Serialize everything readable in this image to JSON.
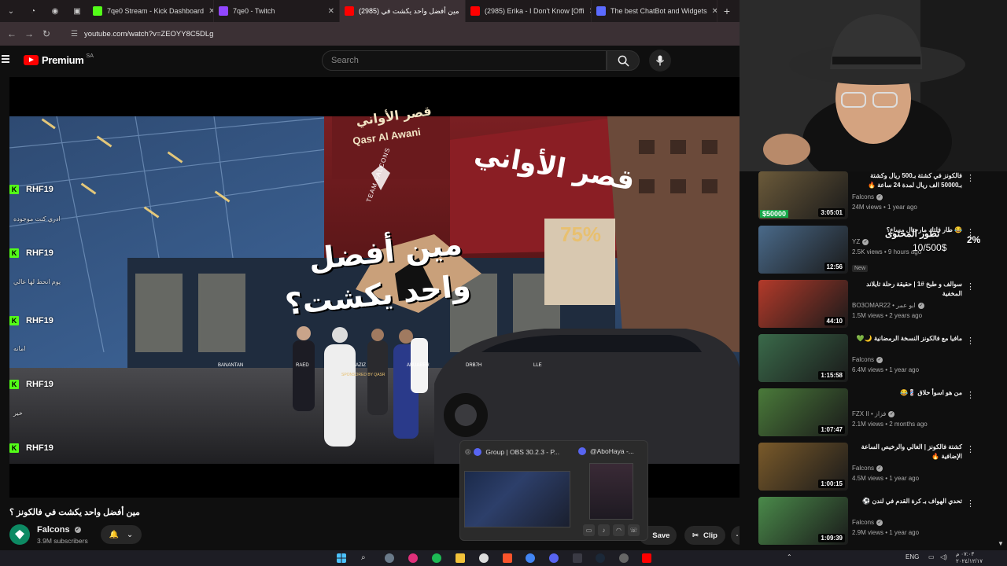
{
  "browser": {
    "tabs": [
      {
        "label": "7qe0 Stream - Kick Dashboard",
        "color": "#53fc18",
        "active": false
      },
      {
        "label": "7qe0 - Twitch",
        "color": "#9146ff",
        "active": false
      },
      {
        "label": "(2985) مين أفضل واحد يكشت في",
        "color": "#ff0000",
        "active": true
      },
      {
        "label": "(2985) Erika - I Don't Know [Offi",
        "color": "#ff0000",
        "active": false
      },
      {
        "label": "The best ChatBot and Widgets",
        "color": "#5b6bff",
        "active": false
      }
    ],
    "url": "youtube.com/watch?v=ZEOYY8C5DLg"
  },
  "youtube": {
    "brand": "Premium",
    "country": "SA",
    "search_placeholder": "Search"
  },
  "video": {
    "title": "مين أفضل واحد يكشت في فالكونز ؟",
    "overlay_line1": "مين أفضل",
    "overlay_line2": "واحد يكشت؟",
    "shop_sign": "قصر الأواني",
    "shop_sign_latin": "Qasr Al Awani",
    "team_text": "TEAM FALCONS",
    "promo": "75%",
    "people_labels": [
      "BANANTAN",
      "RAED",
      "AZIZ",
      "ABUABER",
      "DRB7H",
      "LLE"
    ],
    "sponsor": "SPONSORED BY QASR"
  },
  "chat_overlay": {
    "messages": [
      {
        "user": "RHF19",
        "text": "ادري كنت موجوده"
      },
      {
        "user": "RHF19",
        "text": "يوم انحط لها عالي"
      },
      {
        "user": "RHF19",
        "text": "امانه"
      },
      {
        "user": "RHF19",
        "text": "خير"
      },
      {
        "user": "RHF19",
        "text": ""
      }
    ]
  },
  "channel": {
    "name": "Falcons",
    "subscribers": "3.9M subscribers"
  },
  "actions": {
    "save": "Save",
    "clip": "Clip"
  },
  "taskbar_preview": {
    "item1": "Group | OBS 30.2.3 - P...",
    "item2": "@AboHaya -..."
  },
  "goal": {
    "title": "تطور المحتوى",
    "value": "10/500$",
    "percent": "2%"
  },
  "recommendations": [
    {
      "title": "فالكونز في كشتة بـ500 ريال وكشتة بـ50000 الف ريال لمدة 24 ساعة 🔥",
      "channel": "Falcons",
      "meta": "24M views • 1 year ago",
      "duration": "3:05:01",
      "thumb": "#6b5a3a",
      "tag": "$50000"
    },
    {
      "title": "😂 طار فلتك مارحتال مساع؟",
      "channel": "YZ",
      "meta": "2.5K views • 9 hours ago",
      "duration": "12:56",
      "thumb": "#4a6a8a",
      "new": "New"
    },
    {
      "title": "سوالف و طبخ #1 | حقيقة رحلة تايلاند المخفية",
      "channel": "BO3OMAR22 • ابو عمر",
      "meta": "1.5M views • 2 years ago",
      "duration": "44:10",
      "thumb": "#b33a2a"
    },
    {
      "title": "مافيا مع فالكونز النسخة الرمضانية 🌙💚",
      "channel": "Falcons",
      "meta": "6.4M views • 1 year ago",
      "duration": "1:15:58",
      "thumb": "#3a6a4a"
    },
    {
      "title": "من هو اسوأ حلاق 💈😂",
      "channel": "FZX II • فزاز",
      "meta": "2.1M views • 2 months ago",
      "duration": "1:07:47",
      "thumb": "#4a7a3a"
    },
    {
      "title": "كشتة فالكونز | الغالي والرخيص الساعة الإضافية 🔥",
      "channel": "Falcons",
      "meta": "4.5M views • 1 year ago",
      "duration": "1:00:15",
      "thumb": "#7a5a2a"
    },
    {
      "title": "تحدي الهواف بـ كرة القدم في لندن ⚽",
      "channel": "Falcons",
      "meta": "2.9M views • 1 year ago",
      "duration": "1:09:39",
      "thumb": "#4a8a4a"
    }
  ],
  "system": {
    "lang": "ENG",
    "time": "٠٧:٠٣ م",
    "date": "٢٠٢٤/١٢/١٧"
  }
}
